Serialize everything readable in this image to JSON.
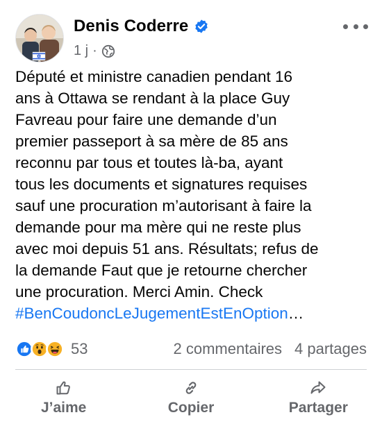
{
  "post": {
    "author": "Denis Coderre",
    "time": "1 j",
    "separator": "·",
    "text_lines": [
      "Député et ministre canadien pendant 16",
      "ans à Ottawa se rendant à la place Guy",
      "Favreau pour faire une demande d’un",
      "premier passeport à sa mère de 85 ans",
      "reconnu par tous et toutes là-ba, ayant",
      "tous les documents et signatures requises",
      "sauf une procuration m’autorisant à faire la",
      "demande pour ma mère qui ne reste plus",
      "avec moi depuis 51 ans. Résultats; refus de",
      "la demande Faut que je retourne chercher",
      "une procuration. Merci Amin. Check"
    ],
    "hashtag": "#BenCoudoncLeJugementEstEnOption",
    "ellipsis": "…"
  },
  "reactions": {
    "icons": [
      "like-icon",
      "wow-icon",
      "haha-icon"
    ],
    "count": "53",
    "comments": "2 commentaires",
    "shares": "4 partages"
  },
  "actions": {
    "like_label": "J’aime",
    "copy_label": "Copier",
    "share_label": "Partager"
  },
  "colors": {
    "link": "#1877f2",
    "secondary": "#65676b",
    "like": "#1877f2",
    "emoji": "#f7b125"
  }
}
